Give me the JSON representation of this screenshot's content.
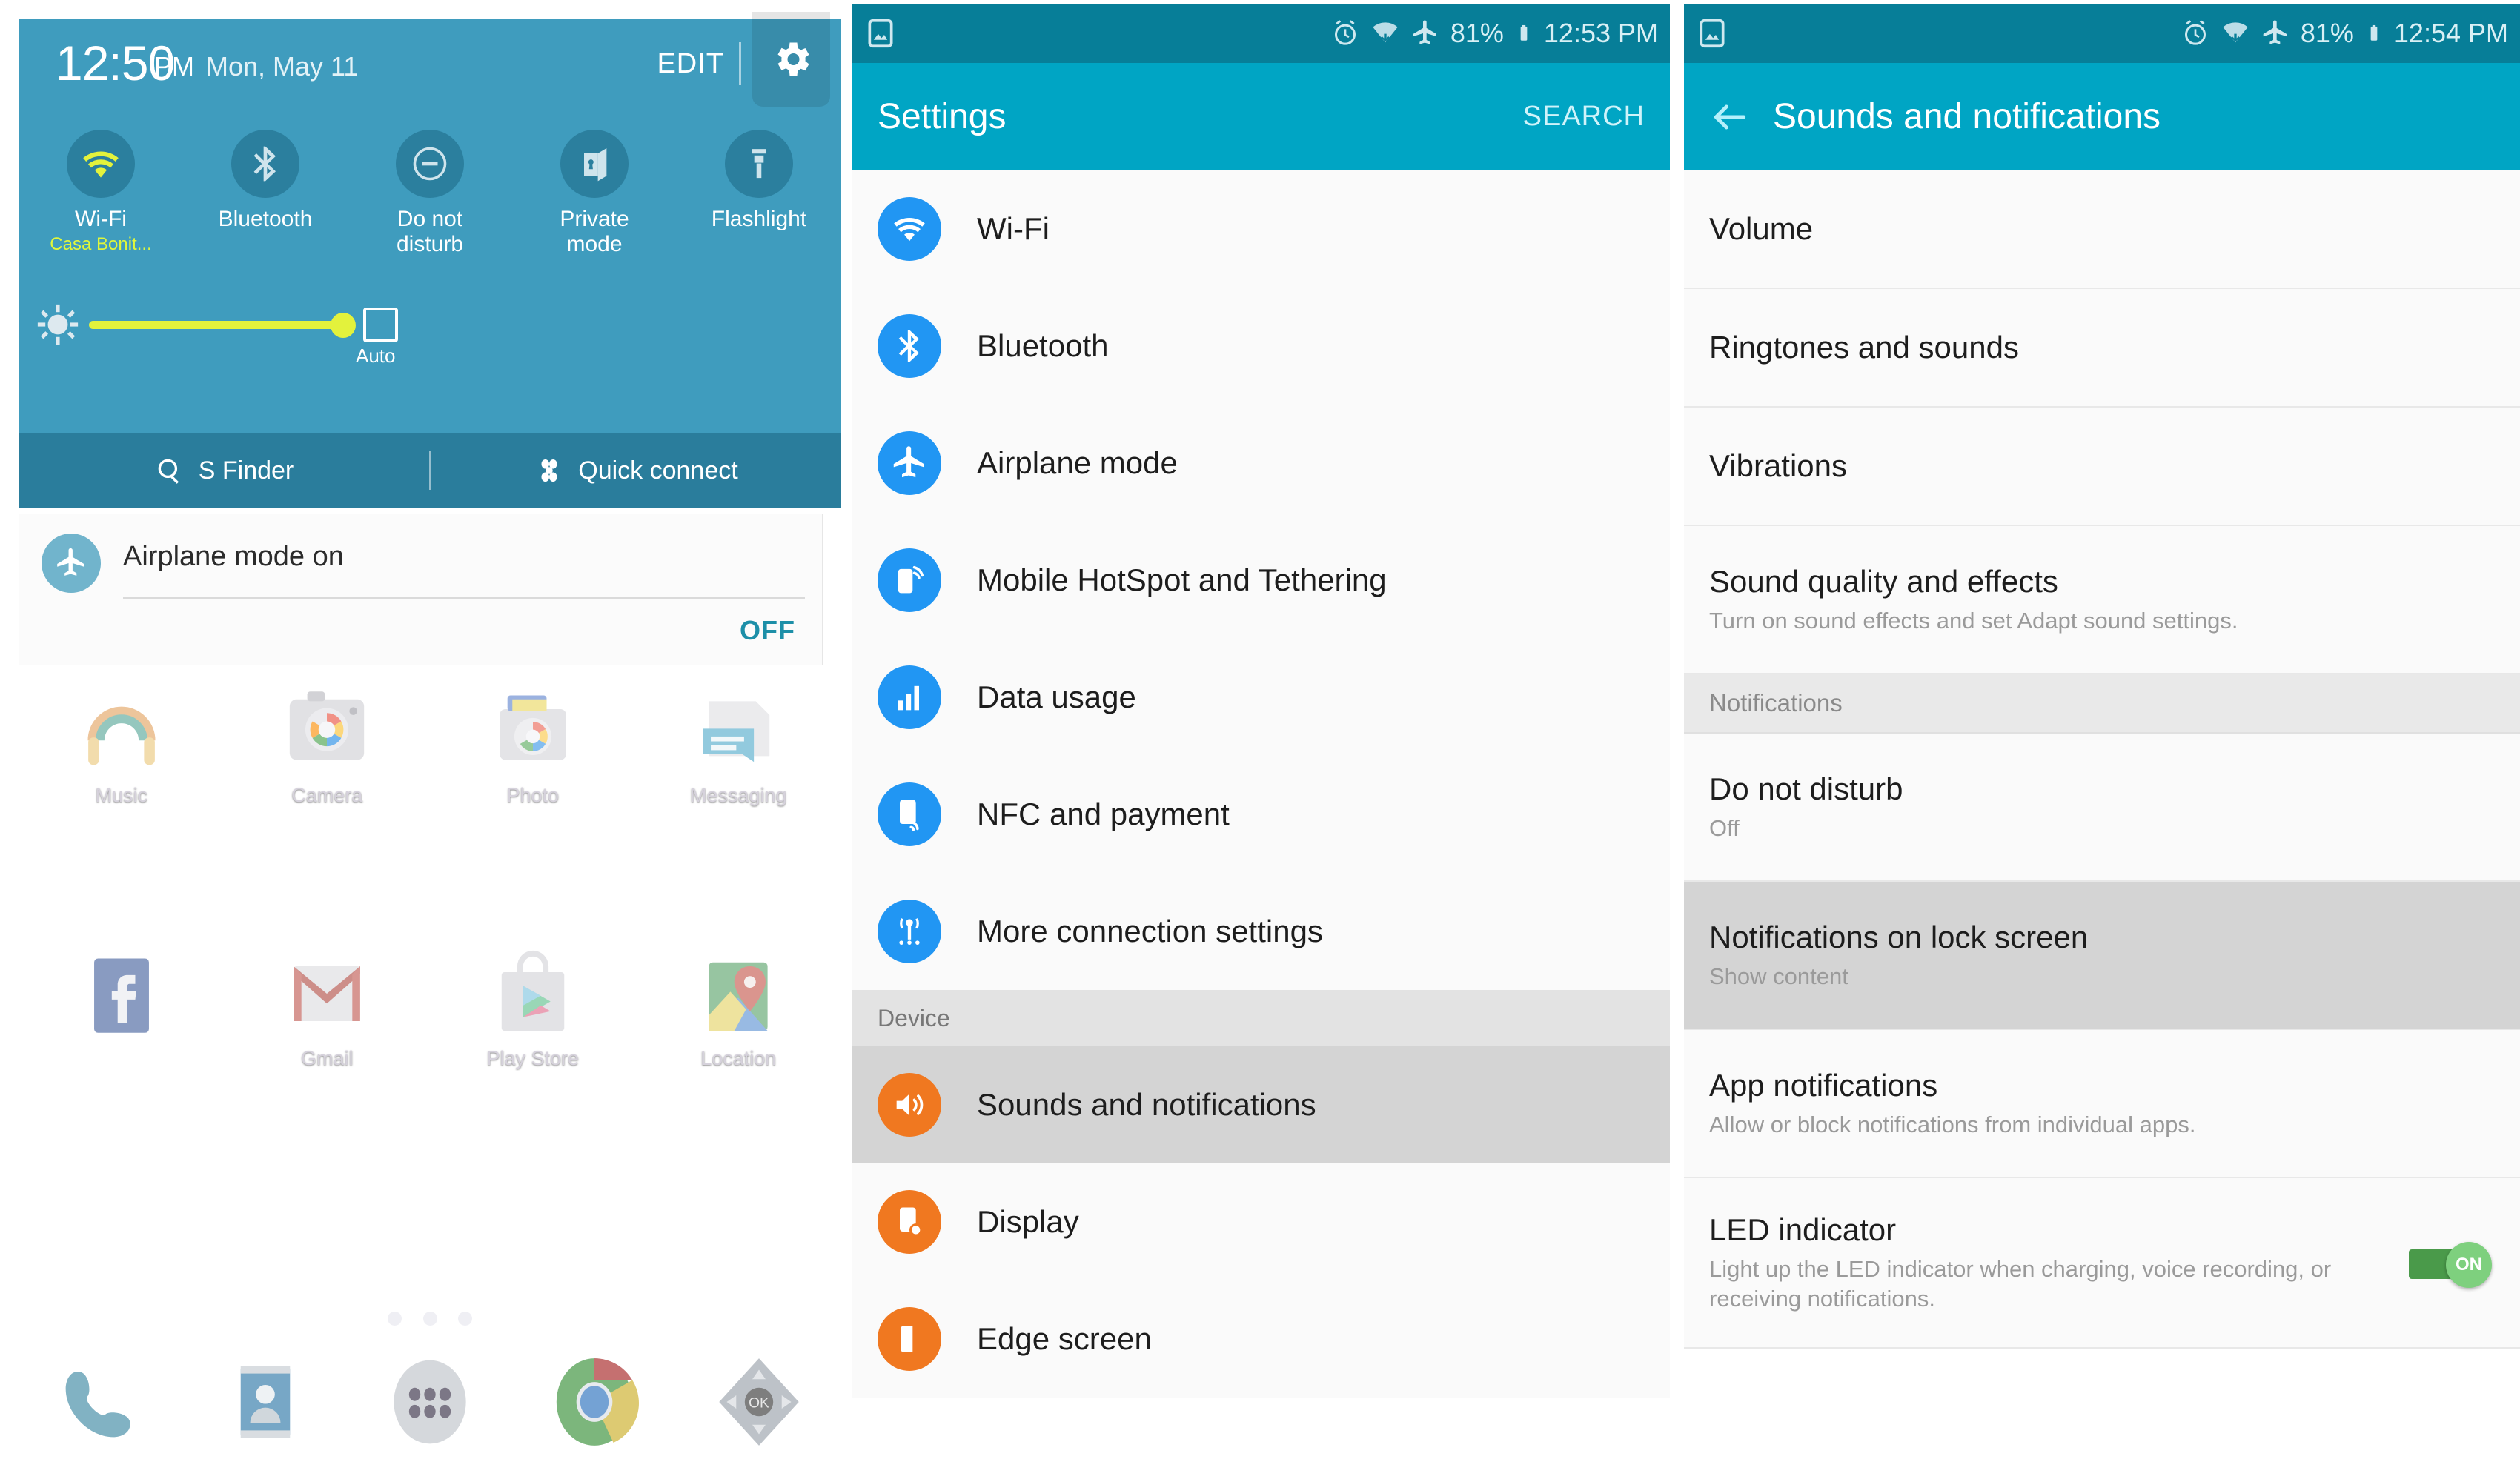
{
  "panel_notification": {
    "clock": {
      "time": "12:50",
      "ampm": "PM",
      "date": "Mon, May 11"
    },
    "edit_label": "EDIT",
    "gear_icon": "gear-icon",
    "toggles": [
      {
        "label": "Wi-Fi",
        "sub": "Casa Bonit...",
        "icon": "wifi-icon",
        "state": "on"
      },
      {
        "label": "Bluetooth",
        "sub": "",
        "icon": "bluetooth-icon",
        "state": "off"
      },
      {
        "label": "Do not\ndisturb",
        "label1": "Do not",
        "label2": "disturb",
        "icon": "do-not-disturb-icon",
        "state": "off"
      },
      {
        "label": "Private\nmode",
        "label1": "Private",
        "label2": "mode",
        "icon": "private-mode-icon",
        "state": "off"
      },
      {
        "label": "Flashlight",
        "sub": "",
        "icon": "flashlight-icon",
        "state": "off"
      }
    ],
    "brightness": {
      "value": 88,
      "auto_label": "Auto",
      "auto_checked": false,
      "icon": "brightness-icon"
    },
    "quick_actions": [
      {
        "label": "S Finder",
        "icon": "search-icon"
      },
      {
        "label": "Quick connect",
        "icon": "quick-connect-icon"
      }
    ],
    "notification_card": {
      "icon": "airplane-icon",
      "title": "Airplane mode on",
      "action_label": "OFF"
    },
    "home_apps_row1": [
      {
        "label": "Music",
        "icon": "music-icon"
      },
      {
        "label": "Camera",
        "icon": "camera-icon"
      },
      {
        "label": "Photo",
        "icon": "photos-icon"
      },
      {
        "label": "Messaging",
        "icon": "messaging-icon"
      }
    ],
    "home_apps_row2": [
      {
        "label": "",
        "icon": "facebook-icon"
      },
      {
        "label": "Gmail",
        "icon": "gmail-icon"
      },
      {
        "label": "Play Store",
        "icon": "play-store-icon"
      },
      {
        "label": "Location",
        "icon": "maps-icon"
      }
    ],
    "page_dots": 3,
    "dock": [
      {
        "icon": "phone-icon"
      },
      {
        "icon": "contacts-icon"
      },
      {
        "icon": "apps-grid-icon"
      },
      {
        "icon": "chrome-icon"
      },
      {
        "icon": "dpad-ok-icon"
      }
    ]
  },
  "panel_settings": {
    "statusbar": {
      "left_icon": "image-icon",
      "icons": [
        "alarm-icon",
        "wifi-icon",
        "airplane-icon"
      ],
      "battery_percent": "81%",
      "battery_icon": "battery-icon",
      "time": "12:53 PM"
    },
    "appbar": {
      "title": "Settings",
      "action": "SEARCH"
    },
    "items": [
      {
        "label": "Wi-Fi",
        "icon": "wifi-icon",
        "color": "#2196f3",
        "selected": false
      },
      {
        "label": "Bluetooth",
        "icon": "bluetooth-icon",
        "color": "#2196f3",
        "selected": false
      },
      {
        "label": "Airplane mode",
        "icon": "airplane-icon",
        "color": "#2196f3",
        "selected": false
      },
      {
        "label": "Mobile HotSpot and Tethering",
        "icon": "hotspot-icon",
        "color": "#2196f3",
        "selected": false
      },
      {
        "label": "Data usage",
        "icon": "data-usage-icon",
        "color": "#2196f3",
        "selected": false
      },
      {
        "label": "NFC and payment",
        "icon": "nfc-icon",
        "color": "#2196f3",
        "selected": false
      },
      {
        "label": "More connection settings",
        "icon": "more-connections-icon",
        "color": "#2196f3",
        "selected": false
      }
    ],
    "section_device": "Device",
    "device_items": [
      {
        "label": "Sounds and notifications",
        "icon": "sound-icon",
        "color": "#f07820",
        "selected": true
      },
      {
        "label": "Display",
        "icon": "display-icon",
        "color": "#f07820",
        "selected": false
      },
      {
        "label": "Edge screen",
        "icon": "edge-screen-icon",
        "color": "#f07820",
        "selected": false
      }
    ]
  },
  "panel_sounds": {
    "statusbar": {
      "left_icon": "image-icon",
      "icons": [
        "alarm-icon",
        "wifi-icon",
        "airplane-icon"
      ],
      "battery_percent": "81%",
      "battery_icon": "battery-icon",
      "time": "12:54 PM"
    },
    "appbar": {
      "back_icon": "back-arrow-icon",
      "title": "Sounds and notifications"
    },
    "items": [
      {
        "title": "Volume",
        "sub": "",
        "highlight": false,
        "switch": null
      },
      {
        "title": "Ringtones and sounds",
        "sub": "",
        "highlight": false,
        "switch": null
      },
      {
        "title": "Vibrations",
        "sub": "",
        "highlight": false,
        "switch": null
      },
      {
        "title": "Sound quality and effects",
        "sub": "Turn on sound effects and set Adapt sound settings.",
        "highlight": false,
        "switch": null
      }
    ],
    "section_notifications": "Notifications",
    "notification_items": [
      {
        "title": "Do not disturb",
        "sub": "Off",
        "highlight": false,
        "switch": null
      },
      {
        "title": "Notifications on lock screen",
        "sub": "Show content",
        "highlight": true,
        "switch": null
      },
      {
        "title": "App notifications",
        "sub": "Allow or block notifications from individual apps.",
        "highlight": false,
        "switch": null
      },
      {
        "title": "LED indicator",
        "sub": "Light up the LED indicator when charging, voice recording, or receiving notifications.",
        "highlight": false,
        "switch": "ON"
      }
    ]
  },
  "colors": {
    "shade_blue": "#3f9cbe",
    "statusbar_teal": "#077e98",
    "appbar_cyan": "#00a5c4",
    "accent_yellow": "#e3f23c",
    "settings_blue": "#2196f3",
    "device_orange": "#f07820",
    "switch_green": "#4a9a4a",
    "selected_gray": "#d4d4d4"
  }
}
